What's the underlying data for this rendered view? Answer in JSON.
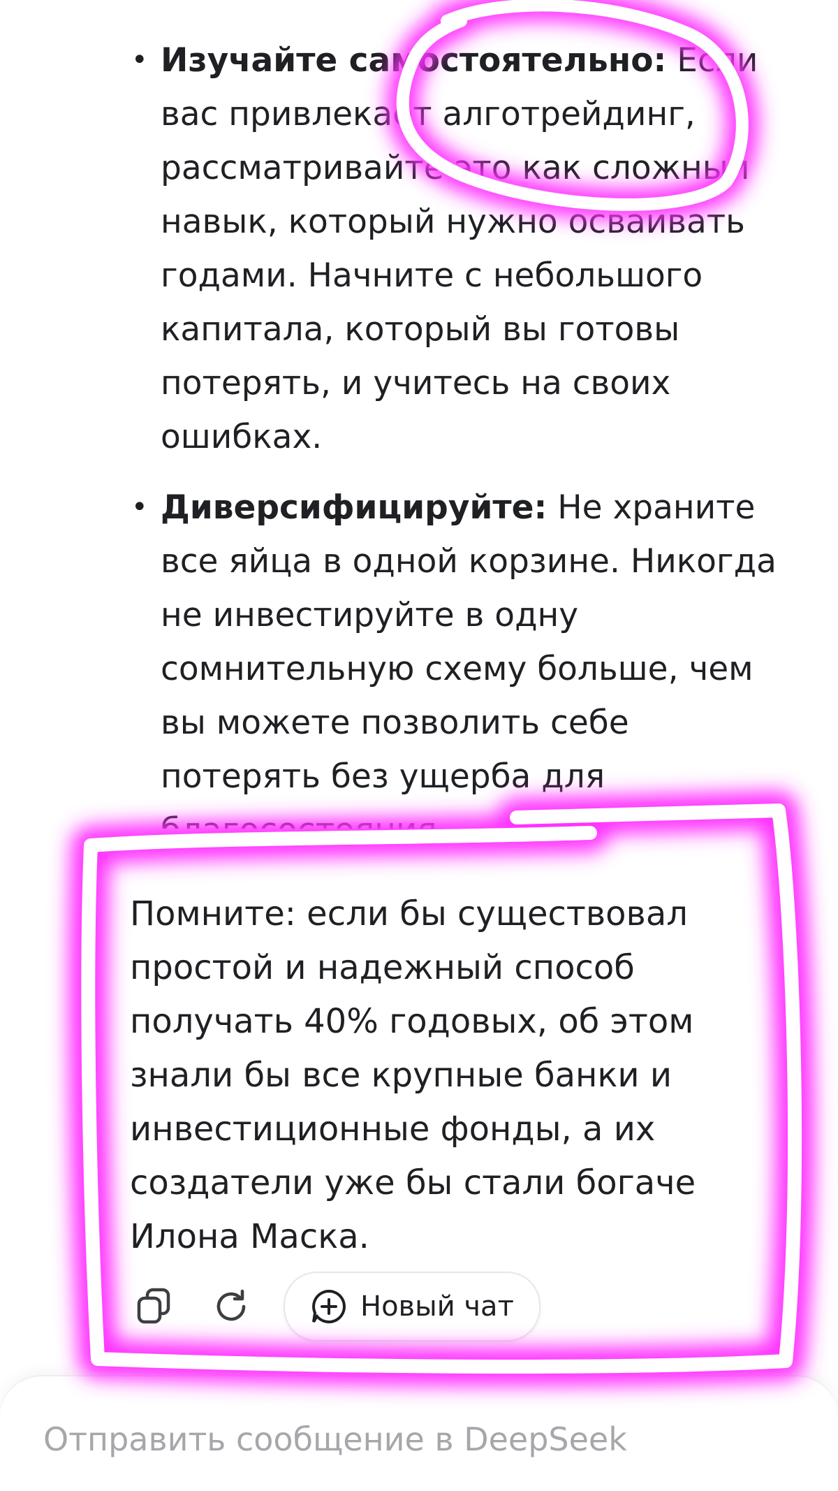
{
  "bullets": [
    {
      "title": "Изучайте самостоятельно:",
      "text": " Если вас привлекает алготрейдинг, рассматривайте это как сложный навык, который нужно осваивать годами. Начните с небольшого капитала, который вы готовы потерять, и учитесь на своих ошибках."
    },
    {
      "title": "Диверсифицируйте:",
      "text": " Не храните все яйца в одной корзине. Никогда не инвестируйте в одну сомнительную схему больше, чем вы можете позволить себе потерять без ущерба для",
      "cut_text": "благосостояния."
    }
  ],
  "reminder": "Помните: если бы существовал простой и надежный способ получать 40% годовых, об этом знали бы все крупные банки и инвестиционные фонды, а их создатели уже бы стали богаче Илона Маска.",
  "actions": {
    "copy_icon": "copy-icon",
    "regenerate_icon": "refresh-icon",
    "new_chat_label": "Новый чат"
  },
  "input": {
    "placeholder": "Отправить сообщение в DeepSeek"
  },
  "colors": {
    "annotation": "#ff33ff",
    "text": "#1f2024",
    "placeholder": "#a6a7ab"
  }
}
